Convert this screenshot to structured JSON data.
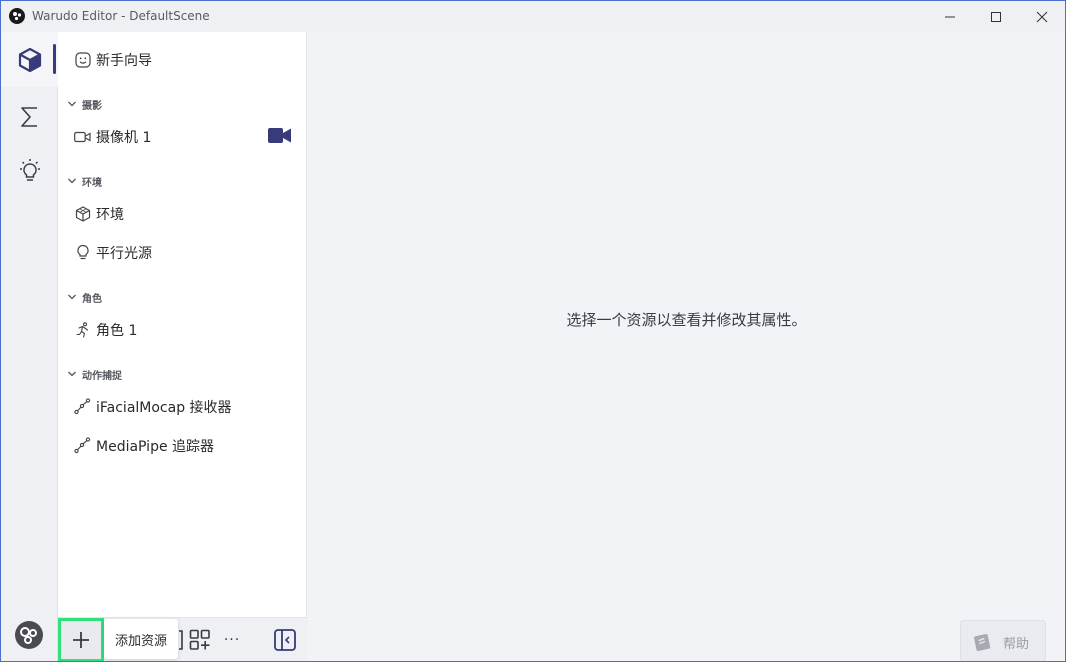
{
  "window": {
    "title": "Warudo Editor - DefaultScene"
  },
  "rail": {
    "items": [
      {
        "name": "scene",
        "icon": "cube-icon"
      },
      {
        "name": "blueprints",
        "icon": "sigma-icon"
      },
      {
        "name": "plugins",
        "icon": "lightbulb-icon"
      }
    ],
    "bottom_icon": "settings-gears-icon"
  },
  "panel": {
    "onboarding": {
      "label": "新手向导",
      "icon": "smiley-icon"
    },
    "sections": [
      {
        "title": "摄影",
        "items": [
          {
            "label": "摄像机 1",
            "icon": "video-camera-icon"
          }
        ]
      },
      {
        "title": "环境",
        "items": [
          {
            "label": "环境",
            "icon": "cube-outline-icon"
          },
          {
            "label": "平行光源",
            "icon": "lightbulb-icon"
          }
        ]
      },
      {
        "title": "角色",
        "items": [
          {
            "label": "角色 1",
            "icon": "running-person-icon"
          }
        ]
      },
      {
        "title": "动作捕捉",
        "items": [
          {
            "label": "iFacialMocap 接收器",
            "icon": "tracking-nodes-icon"
          },
          {
            "label": "MediaPipe 追踪器",
            "icon": "tracking-nodes-icon"
          }
        ]
      }
    ]
  },
  "toolbar": {
    "add_tooltip": "添加资源",
    "more_label": "···"
  },
  "main": {
    "empty_message": "选择一个资源以查看并修改其属性。",
    "help_label": "帮助"
  },
  "colors": {
    "accent": "#383a7a",
    "highlight": "#2fe07b"
  }
}
